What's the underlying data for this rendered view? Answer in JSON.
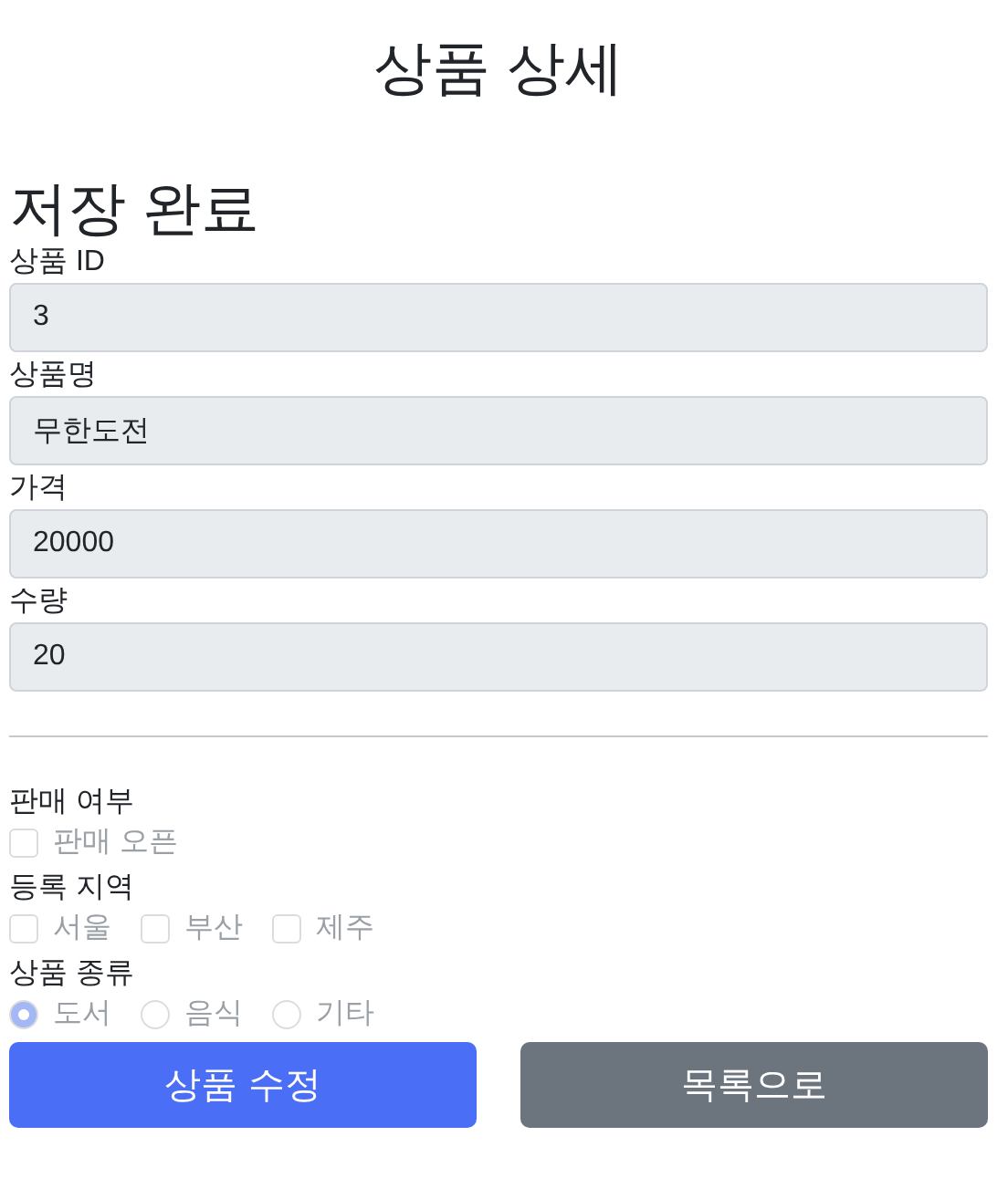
{
  "page_title": "상품 상세",
  "status_message": "저장 완료",
  "fields": [
    {
      "label": "상품 ID",
      "value": "3"
    },
    {
      "label": "상품명",
      "value": "무한도전"
    },
    {
      "label": "가격",
      "value": "20000"
    },
    {
      "label": "수량",
      "value": "20"
    }
  ],
  "groups": [
    {
      "label": "판매 여부",
      "kind": "checkbox",
      "disabled": true,
      "options": [
        {
          "label": "판매 오픈",
          "checked": false
        }
      ]
    },
    {
      "label": "등록 지역",
      "kind": "checkbox",
      "disabled": true,
      "options": [
        {
          "label": "서울",
          "checked": false
        },
        {
          "label": "부산",
          "checked": false
        },
        {
          "label": "제주",
          "checked": false
        }
      ]
    },
    {
      "label": "상품 종류",
      "kind": "radio",
      "disabled": true,
      "options": [
        {
          "label": "도서",
          "selected": true
        },
        {
          "label": "음식",
          "selected": false
        },
        {
          "label": "기타",
          "selected": false
        }
      ]
    }
  ],
  "buttons": [
    {
      "label": "상품 수정",
      "kind": "primary"
    },
    {
      "label": "목록으로",
      "kind": "secondary"
    }
  ]
}
